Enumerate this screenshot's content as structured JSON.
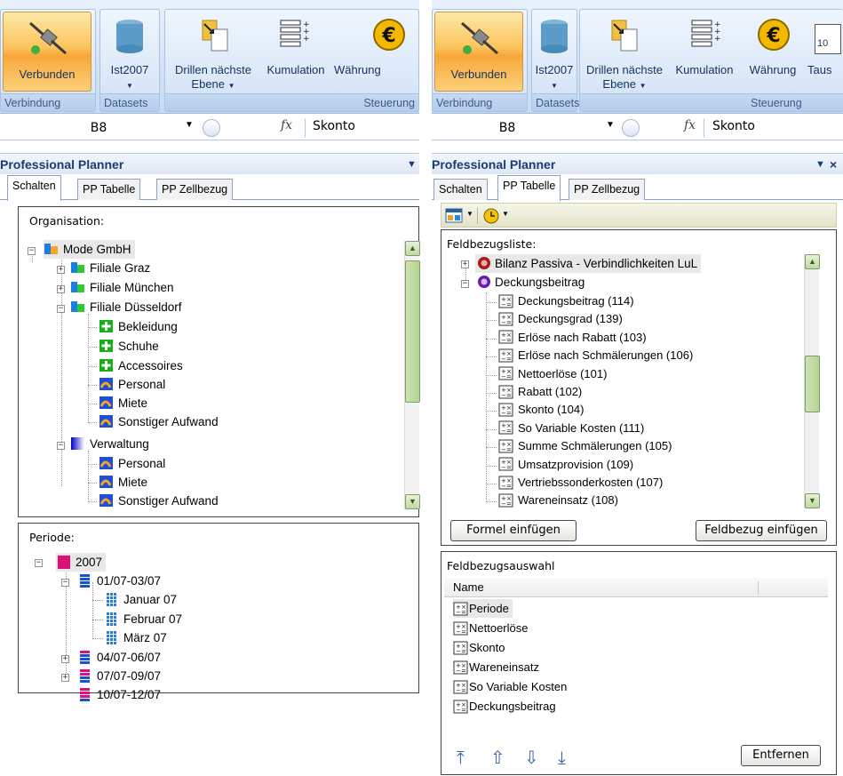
{
  "ribbon": {
    "buttons": {
      "verbunden": "Verbunden",
      "ist2007": "Ist2007",
      "drillen_line1": "Drillen nächste",
      "drillen_line2": "Ebene",
      "kumulation": "Kumulation",
      "waehrung": "Währung",
      "tausch_cut": "Taus",
      "tausch_icon_text": "10"
    },
    "groups": {
      "verbindung": "Verbindung",
      "datasets": "Datasets",
      "steuerung_left": "Steuerung",
      "steuerung_right": "Steuerung"
    }
  },
  "formula_bar": {
    "cell_ref": "B8",
    "fx": "fx",
    "value": "Skonto"
  },
  "pane": {
    "title": "Professional Planner",
    "tabs": [
      "Schalten",
      "PP Tabelle",
      "PP Zellbezug"
    ]
  },
  "left": {
    "organisation": {
      "title": "Organisation:",
      "items": [
        "Mode GmbH",
        "Filiale Graz",
        "Filiale München",
        "Filiale Düsseldorf",
        "Bekleidung",
        "Schuhe",
        "Accessoires",
        "Personal",
        "Miete",
        "Sonstiger Aufwand",
        "Verwaltung",
        "Personal",
        "Miete",
        "Sonstiger Aufwand"
      ]
    },
    "periode": {
      "title": "Periode:",
      "items": [
        "2007",
        "01/07-03/07",
        "Januar 07",
        "Februar 07",
        "März 07",
        "04/07-06/07",
        "07/07-09/07",
        "10/07-12/07"
      ]
    }
  },
  "right": {
    "feldbezugsliste": {
      "title": "Feldbezugsliste:",
      "items": [
        "Bilanz Passiva - Verbindlichkeiten LuL",
        "Deckungsbeitrag",
        "Deckungsbeitrag (114)",
        "Deckungsgrad (139)",
        "Erlöse nach Rabatt (103)",
        "Erlöse nach Schmälerungen (106)",
        "Nettoerlöse (101)",
        "Rabatt (102)",
        "Skonto (104)",
        "So Variable Kosten (111)",
        "Summe Schmälerungen (105)",
        "Umsatzprovision (109)",
        "Vertriebssonderkosten (107)",
        "Wareneinsatz (108)"
      ],
      "btn_formel": "Formel einfügen",
      "btn_feldbezug": "Feldbezug einfügen"
    },
    "feldbezugsauswahl": {
      "title": "Feldbezugsauswahl",
      "column": "Name",
      "items": [
        "Periode",
        "Nettoerlöse",
        "Skonto",
        "Wareneinsatz",
        "So Variable Kosten",
        "Deckungsbeitrag"
      ],
      "btn_entfernen": "Entfernen"
    }
  }
}
